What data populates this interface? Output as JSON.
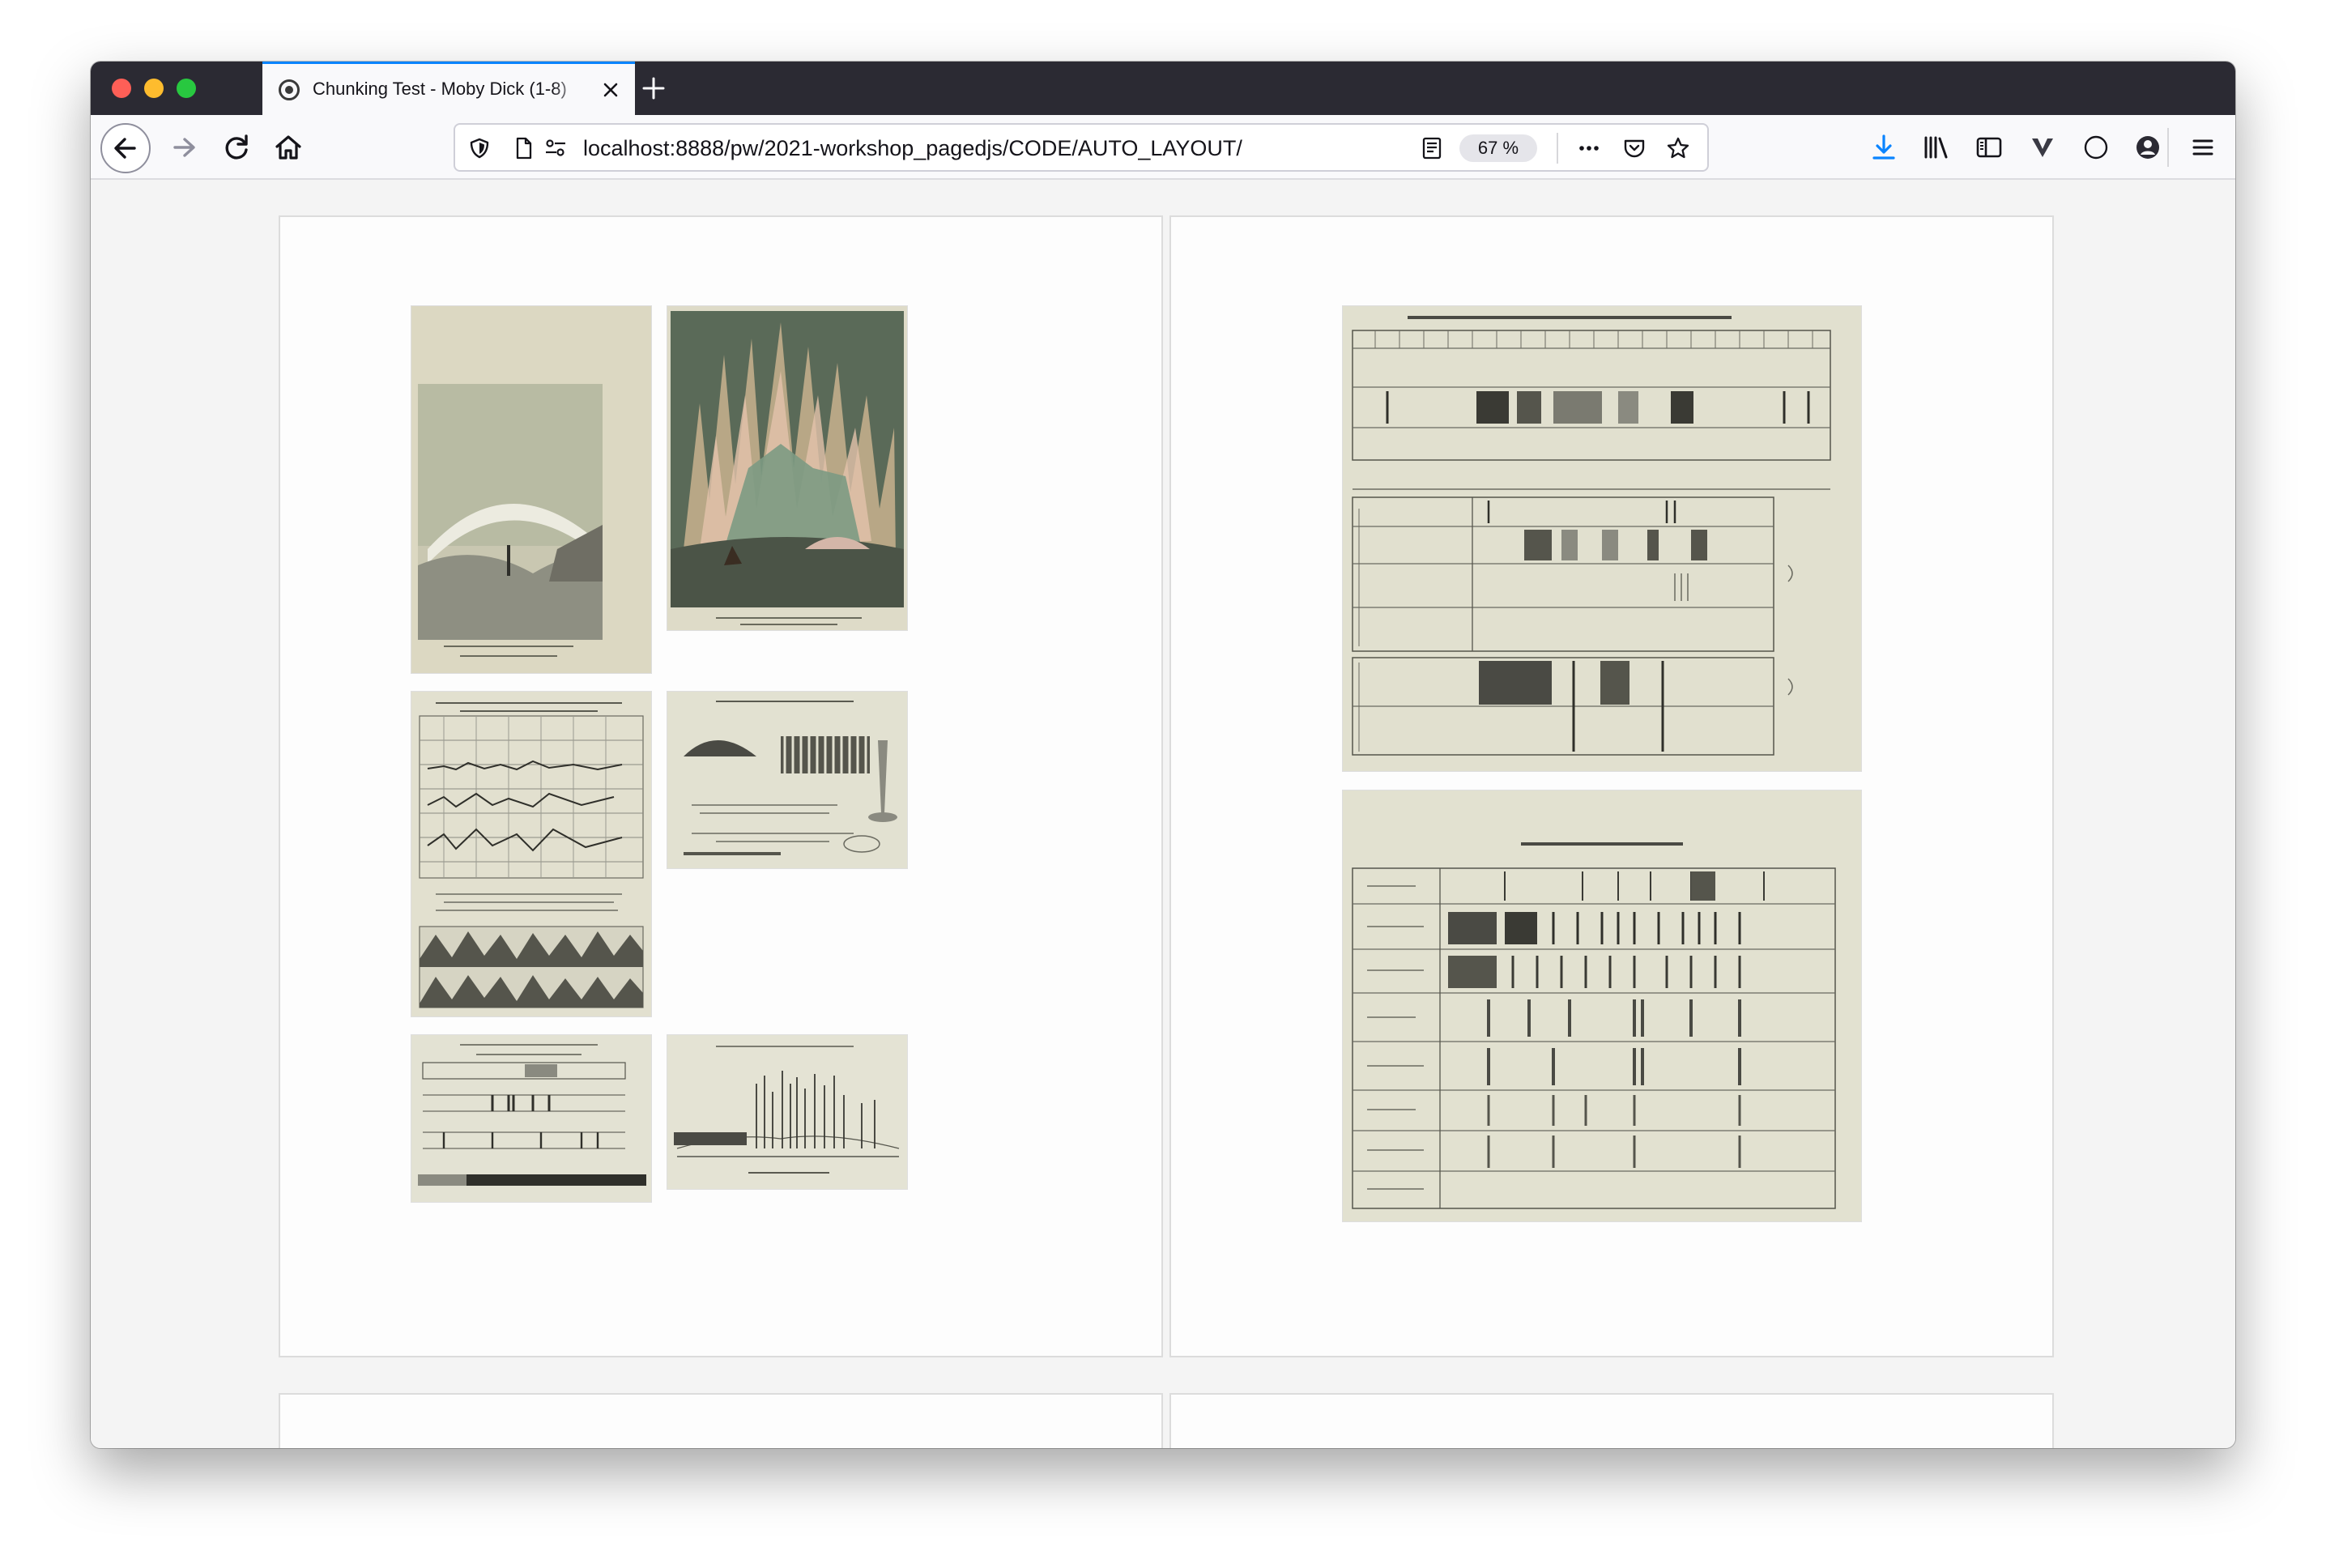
{
  "browser": {
    "tab": {
      "title": "Chunking Test - Moby Dick (1-8)",
      "favicon": "globe-icon"
    },
    "url": "localhost:8888/pw/2021-workshop_pagedjs/CODE/AUTO_LAYOUT/",
    "zoom": "67 %",
    "accent_color": "#0a84ff",
    "toolbar_icons": [
      "back-arrow-icon",
      "forward-arrow-icon",
      "reload-icon",
      "home-icon",
      "shield-icon",
      "page-icon",
      "permissions-icon",
      "reader-view-icon",
      "more-icon",
      "pocket-icon",
      "star-icon",
      "download-icon",
      "library-icon",
      "sidebar-icon",
      "extension-icon",
      "circle-icon",
      "account-icon",
      "menu-icon"
    ]
  },
  "pages": [
    {
      "side": "left",
      "plates": [
        "aurora-landscape-arc",
        "aurora-color-rays",
        "aurora-spectra-chart",
        "aurora-instrument-drawings",
        "aurora-spectrum-scale",
        "spectrum-of-the-aurora"
      ]
    },
    {
      "side": "right",
      "plates": [
        "aurora-lines-micrometer-scale",
        "aurora-hydrocarbons-oxygen"
      ]
    }
  ],
  "colors": {
    "plate_paper": "#e4e3d2",
    "plate_ink": "#3c3c36",
    "aurora_green": "#5f6b55",
    "aurora_rose": "#d9b29a"
  }
}
